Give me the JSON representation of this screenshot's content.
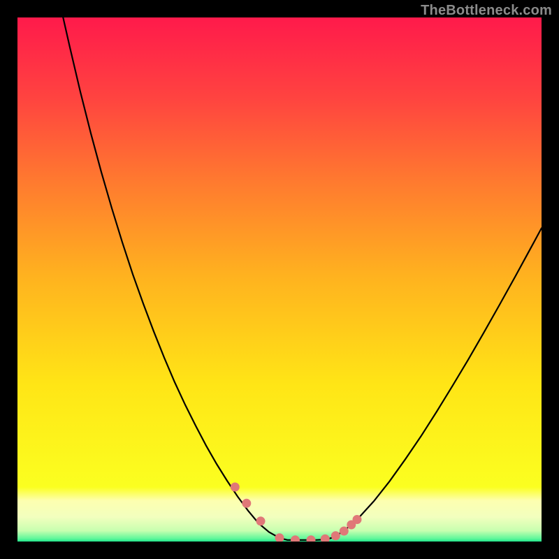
{
  "watermark": "TheBottleneck.com",
  "colors": {
    "background": "#000000",
    "curve": "#000000",
    "marker": "#e07878",
    "gradient_top": "#ff1a4b",
    "gradient_bottom": "#1fe28a"
  },
  "chart_data": {
    "type": "line",
    "title": "",
    "xlabel": "",
    "ylabel": "",
    "xlim": [
      0,
      100
    ],
    "ylim": [
      0,
      100
    ],
    "x": [
      8.7,
      10,
      12,
      14,
      16,
      18,
      20,
      22,
      24,
      26,
      28,
      30,
      32,
      34,
      36,
      38,
      40,
      42,
      44,
      46,
      48,
      50,
      51.5,
      53,
      55,
      57,
      59,
      60.5,
      62.5,
      65,
      68,
      71,
      74,
      77,
      80,
      83,
      86,
      89,
      92,
      95,
      98,
      100
    ],
    "y": [
      100,
      94.3,
      85.8,
      77.9,
      70.5,
      63.6,
      57.1,
      51.0,
      45.4,
      40.1,
      35.1,
      30.4,
      26.1,
      22.1,
      18.3,
      14.8,
      11.6,
      8.6,
      5.9,
      3.5,
      1.8,
      0.7,
      0.3,
      0.3,
      0.3,
      0.3,
      0.4,
      0.9,
      2.2,
      4.4,
      7.7,
      11.5,
      15.7,
      20.1,
      24.8,
      29.7,
      34.7,
      39.9,
      45.2,
      50.6,
      56.1,
      59.8
    ],
    "markers_x": [
      41.5,
      43.7,
      46.4,
      50.0,
      53.0,
      56.0,
      58.7,
      60.7,
      62.3,
      63.7,
      64.8
    ],
    "markers_y": [
      10.4,
      7.3,
      3.9,
      0.7,
      0.3,
      0.3,
      0.5,
      1.1,
      2.0,
      3.2,
      4.2
    ],
    "marker_radius": 6.5
  }
}
